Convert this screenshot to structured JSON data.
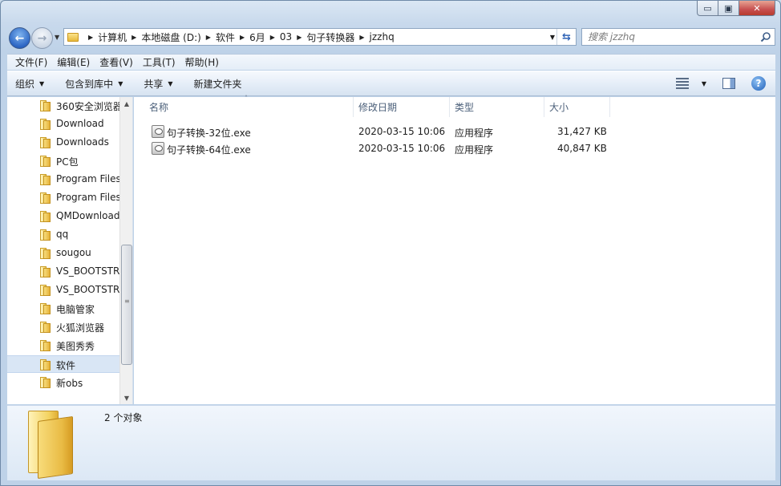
{
  "window": {
    "buttons": {
      "min": "▭",
      "max": "▣",
      "close": "✕"
    }
  },
  "nav": {
    "back_glyph": "←",
    "forward_glyph": "→",
    "breadcrumbs": [
      "计算机",
      "本地磁盘 (D:)",
      "软件",
      "6月",
      "03",
      "句子转换器",
      "jzzhq"
    ],
    "search_placeholder": "搜索 jzzhq"
  },
  "menu": [
    "文件(F)",
    "编辑(E)",
    "查看(V)",
    "工具(T)",
    "帮助(H)"
  ],
  "toolbar": {
    "organize": "组织",
    "include_library": "包含到库中",
    "share": "共享",
    "new_folder": "新建文件夹"
  },
  "tree": [
    {
      "label": "360安全浏览器"
    },
    {
      "label": "Download"
    },
    {
      "label": "Downloads"
    },
    {
      "label": "PC包"
    },
    {
      "label": "Program Files"
    },
    {
      "label": "Program Files"
    },
    {
      "label": "QMDownload"
    },
    {
      "label": "qq"
    },
    {
      "label": "sougou"
    },
    {
      "label": "VS_BOOTSTRAPPER"
    },
    {
      "label": "VS_BOOTSTRAPPER"
    },
    {
      "label": "电脑管家"
    },
    {
      "label": "火狐浏览器"
    },
    {
      "label": "美图秀秀"
    },
    {
      "label": "软件",
      "selected": true
    },
    {
      "label": "新obs"
    }
  ],
  "columns": {
    "name": "名称",
    "modified": "修改日期",
    "type": "类型",
    "size": "大小"
  },
  "files": [
    {
      "name": "句子转换-32位.exe",
      "modified": "2020-03-15 10:06",
      "type": "应用程序",
      "size": "31,427 KB"
    },
    {
      "name": "句子转换-64位.exe",
      "modified": "2020-03-15 10:06",
      "type": "应用程序",
      "size": "40,847 KB"
    }
  ],
  "details": {
    "count_text": "2 个对象"
  }
}
